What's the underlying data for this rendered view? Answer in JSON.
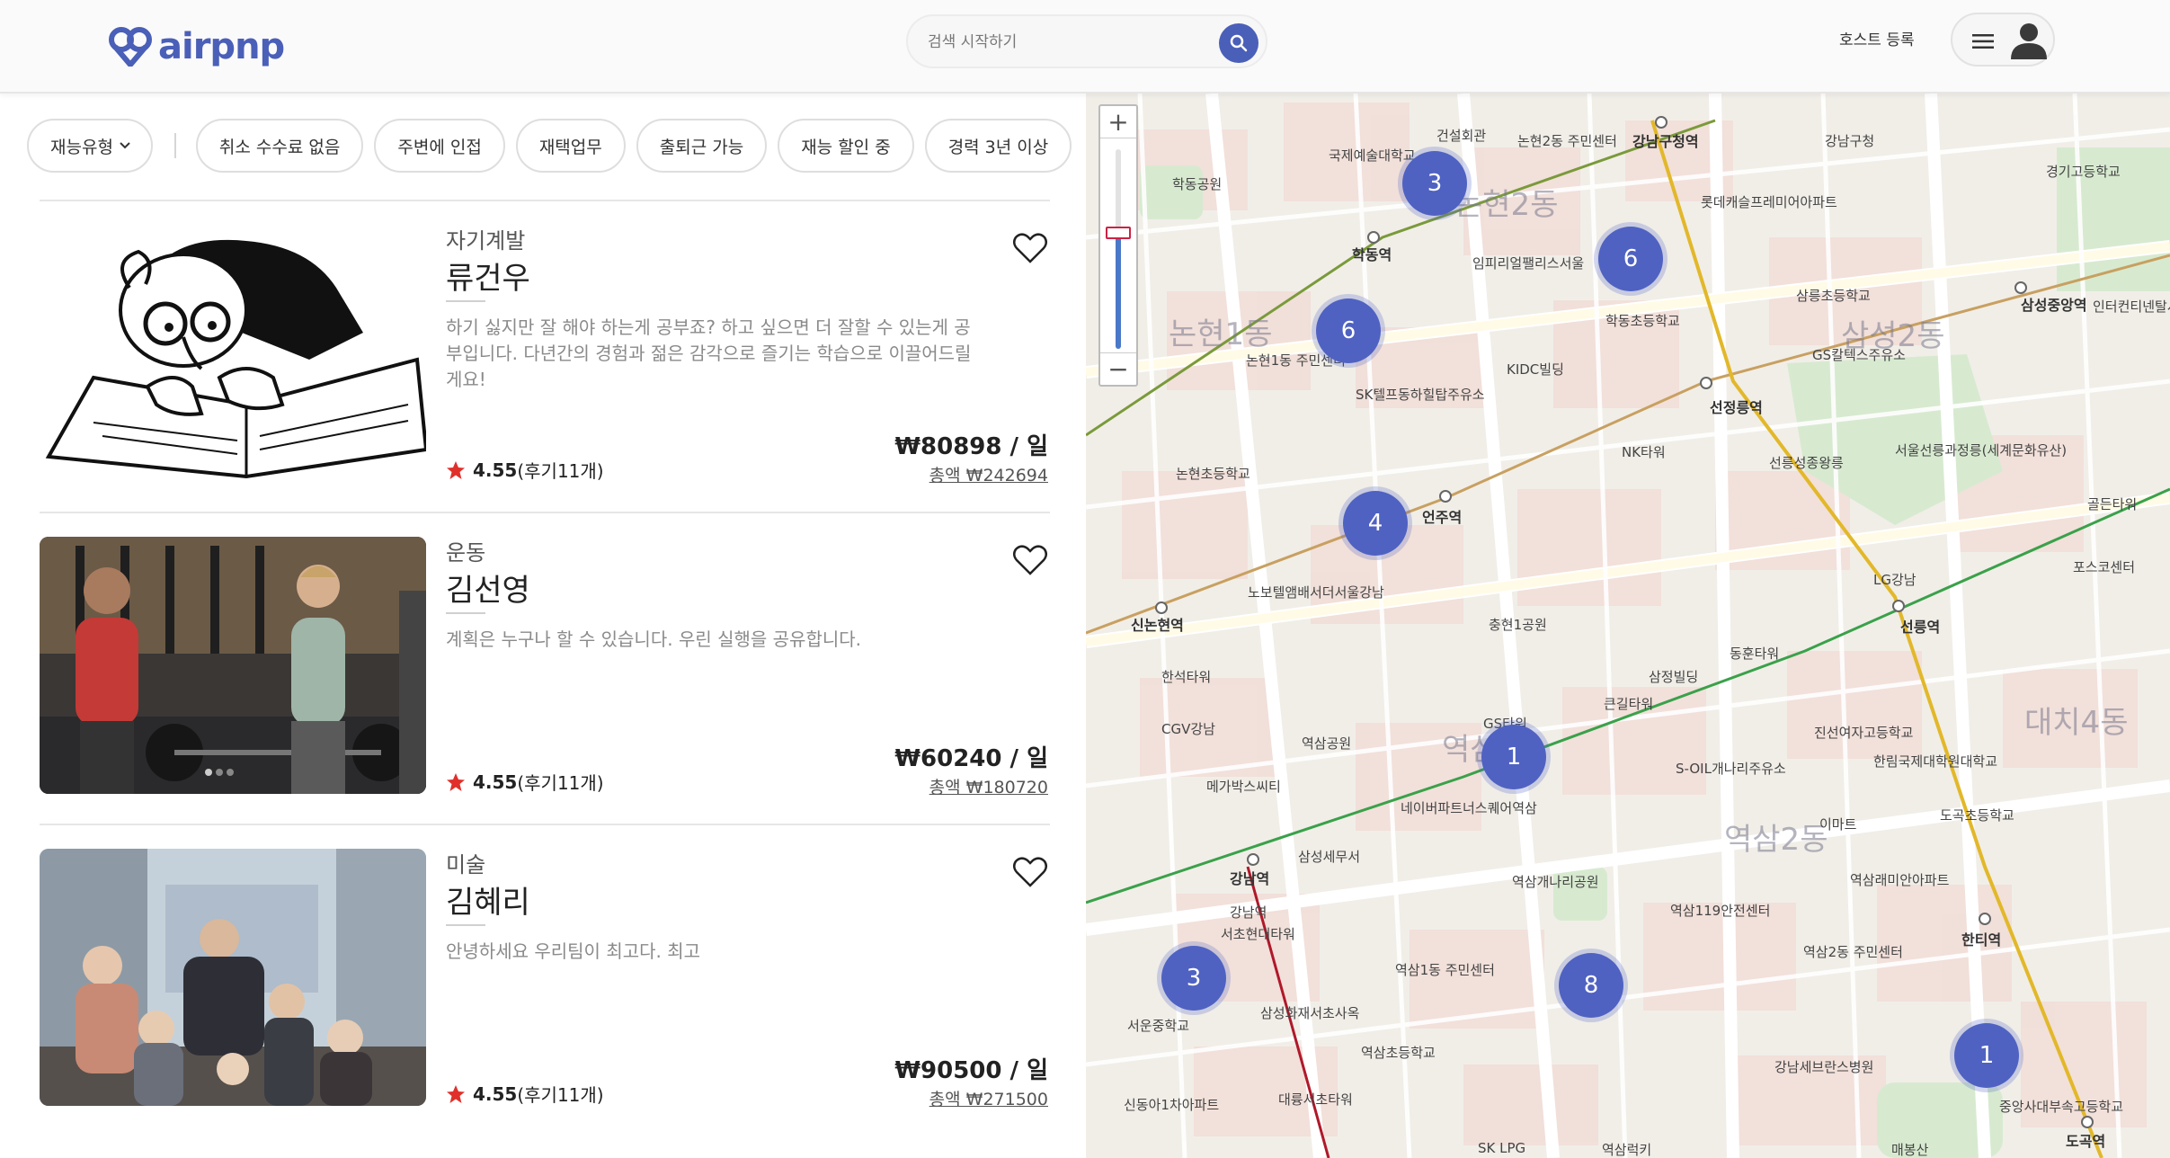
{
  "header": {
    "logo_text": "airpnp",
    "search_placeholder": "검색 시작하기",
    "host_link": "호스트 등록"
  },
  "filters": {
    "first": "재능유형",
    "chips": [
      "취소 수수료 없음",
      "주변에 인접",
      "재택업무",
      "출퇴근 가능",
      "재능 할인 중",
      "경력 3년 이상"
    ]
  },
  "listings": [
    {
      "category": "자기계발",
      "name": "류건우",
      "description": "하기 싫지만 잘 해야 하는게 공부죠? 하고 싶으면 더 잘할 수 있는게 공부입니다. 다년간의 경험과 젊은 감각으로 즐기는 학습으로 이끌어드릴게요!",
      "rating": "4.55",
      "reviews": "(후기11개)",
      "price": "₩80898 / 일",
      "total": "총액 ₩242694"
    },
    {
      "category": "운동",
      "name": "김선영",
      "description": "계획은 누구나 할 수 있습니다. 우린 실행을 공유합니다.",
      "rating": "4.55",
      "reviews": "(후기11개)",
      "price": "₩60240 / 일",
      "total": "총액 ₩180720"
    },
    {
      "category": "미술",
      "name": "김혜리",
      "description": "안녕하세요 우리팀이 최고다. 최고",
      "rating": "4.55",
      "reviews": "(후기11개)",
      "price": "₩90500 / 일",
      "total": "총액 ₩271500"
    }
  ],
  "map": {
    "zoom_plus": "+",
    "zoom_minus": "−",
    "zoom_level": 0.58,
    "clusters": [
      "3",
      "6",
      "6",
      "4",
      "1",
      "3",
      "8",
      "1"
    ],
    "district_labels": [
      "논현2동",
      "논현1동",
      "삼성2동",
      "역삼2동",
      "대치4동",
      "역삼"
    ],
    "station_labels": [
      "강남구청역",
      "학동역",
      "선정릉역",
      "삼성중앙역",
      "언주역",
      "신논현역",
      "선릉역",
      "강남역",
      "한티역",
      "도곡역"
    ],
    "place_labels": [
      "학동공원",
      "국제예술대학교",
      "건설회관",
      "논현2동 주민센터",
      "강남구청",
      "경기고등학교",
      "롯데캐슬프레미어아파트",
      "임피리얼팰리스서울",
      "삼릉초등학교",
      "학동초등학교",
      "인터컨티넨탈서울코엑스",
      "논현1동 주민센터",
      "SK텔프동하힐탑주유소",
      "KIDC빌딩",
      "GS칼텍스주유소",
      "NK타워",
      "선릉성종왕릉",
      "서울선릉과정릉(세계문화유산)",
      "골든타워",
      "논현초등학교",
      "노보텔앰배서더서울강남",
      "충현1공원",
      "포스코센터",
      "LG강남",
      "동훈타워",
      "삼정빌딩",
      "한석타워",
      "CGV강남",
      "역삼공원",
      "GS타워",
      "큰길타워",
      "S-OIL개나리주유소",
      "진선여자고등학교",
      "한림국제대학원대학교",
      "메가박스씨티",
      "네이버파트너스퀘어역삼",
      "이마트",
      "도곡초등학교",
      "삼성세무서",
      "역삼개나리공원",
      "강남역",
      "역삼119안전센터",
      "역삼래미안아파트",
      "서초현대타워",
      "역삼1동 주민센터",
      "역삼2동 주민센터",
      "삼성화재서초사옥",
      "서운중학교",
      "신동아1차아파트",
      "역삼초등학교",
      "대륭서초타워",
      "강남세브란스병원",
      "중앙사대부속고등학교",
      "매봉산",
      "SK LPG",
      "역삼럭키"
    ]
  }
}
